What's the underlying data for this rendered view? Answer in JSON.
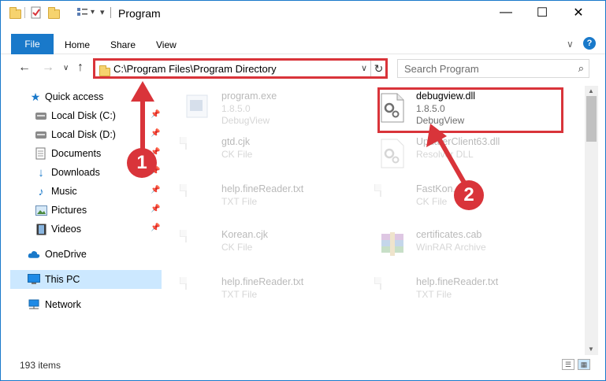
{
  "window": {
    "title": "Program",
    "minimize": "—",
    "maximize": "☐",
    "close": "✕"
  },
  "ribbon": {
    "tabs": [
      "File",
      "Home",
      "Share",
      "View"
    ],
    "chevron": "∨",
    "help": "?"
  },
  "nav": {
    "back": "←",
    "forward": "→",
    "recent": "∨",
    "up": "↑",
    "address": "C:\\Program Files\\Program Directory",
    "address_dropdown": "∨",
    "refresh": "↻",
    "search_placeholder": "Search Program",
    "search_icon": "⌕"
  },
  "sidebar": {
    "items": [
      {
        "label": "Quick access",
        "icon": "star-icon",
        "pinned": false
      },
      {
        "label": "Local Disk (C:)",
        "icon": "drive-icon",
        "pinned": true
      },
      {
        "label": "Local Disk (D:)",
        "icon": "drive-icon",
        "pinned": true
      },
      {
        "label": "Documents",
        "icon": "documents-icon",
        "pinned": true
      },
      {
        "label": "Downloads",
        "icon": "download-icon",
        "pinned": true
      },
      {
        "label": "Music",
        "icon": "music-icon",
        "pinned": true
      },
      {
        "label": "Pictures",
        "icon": "pictures-icon",
        "pinned": true
      },
      {
        "label": "Videos",
        "icon": "videos-icon",
        "pinned": true
      },
      {
        "label": "OneDrive",
        "icon": "cloud-icon",
        "pinned": false
      },
      {
        "label": "This PC",
        "icon": "computer-icon",
        "pinned": false,
        "selected": true
      },
      {
        "label": "Network",
        "icon": "network-icon",
        "pinned": false
      }
    ]
  },
  "files": [
    {
      "name": "program.exe",
      "line1": "1.8.5.0",
      "line2": "DebugView",
      "icon": "exe-icon"
    },
    {
      "name": "debugview.dll",
      "line1": "1.8.5.0",
      "line2": "DebugView",
      "icon": "dll-icon",
      "highlighted": true
    },
    {
      "name": "gtd.cjk",
      "line1": "CK File",
      "line2": "",
      "icon": "document-icon"
    },
    {
      "name": "UpdaterClient63.dll",
      "line1": "Resolver DLL",
      "line2": "",
      "icon": "dll-icon"
    },
    {
      "name": "help.fineReader.txt",
      "line1": "TXT File",
      "line2": "",
      "icon": "document-icon"
    },
    {
      "name": "FastKon...",
      "line1": "CK File",
      "line2": "",
      "icon": "document-icon"
    },
    {
      "name": "Korean.cjk",
      "line1": "CK File",
      "line2": "",
      "icon": "document-icon"
    },
    {
      "name": "certificates.cab",
      "line1": "WinRAR Archive",
      "line2": "",
      "icon": "archive-icon"
    },
    {
      "name": "help.fineReader.txt",
      "line1": "TXT File",
      "line2": "",
      "icon": "document-icon"
    },
    {
      "name": "help.fineReader.txt",
      "line1": "TXT File",
      "line2": "",
      "icon": "document-icon"
    }
  ],
  "status": {
    "count": "193 items"
  },
  "callouts": [
    "1",
    "2"
  ],
  "colors": {
    "accent": "#1979ca",
    "highlight": "#d9343a",
    "selected": "#cce8ff"
  }
}
